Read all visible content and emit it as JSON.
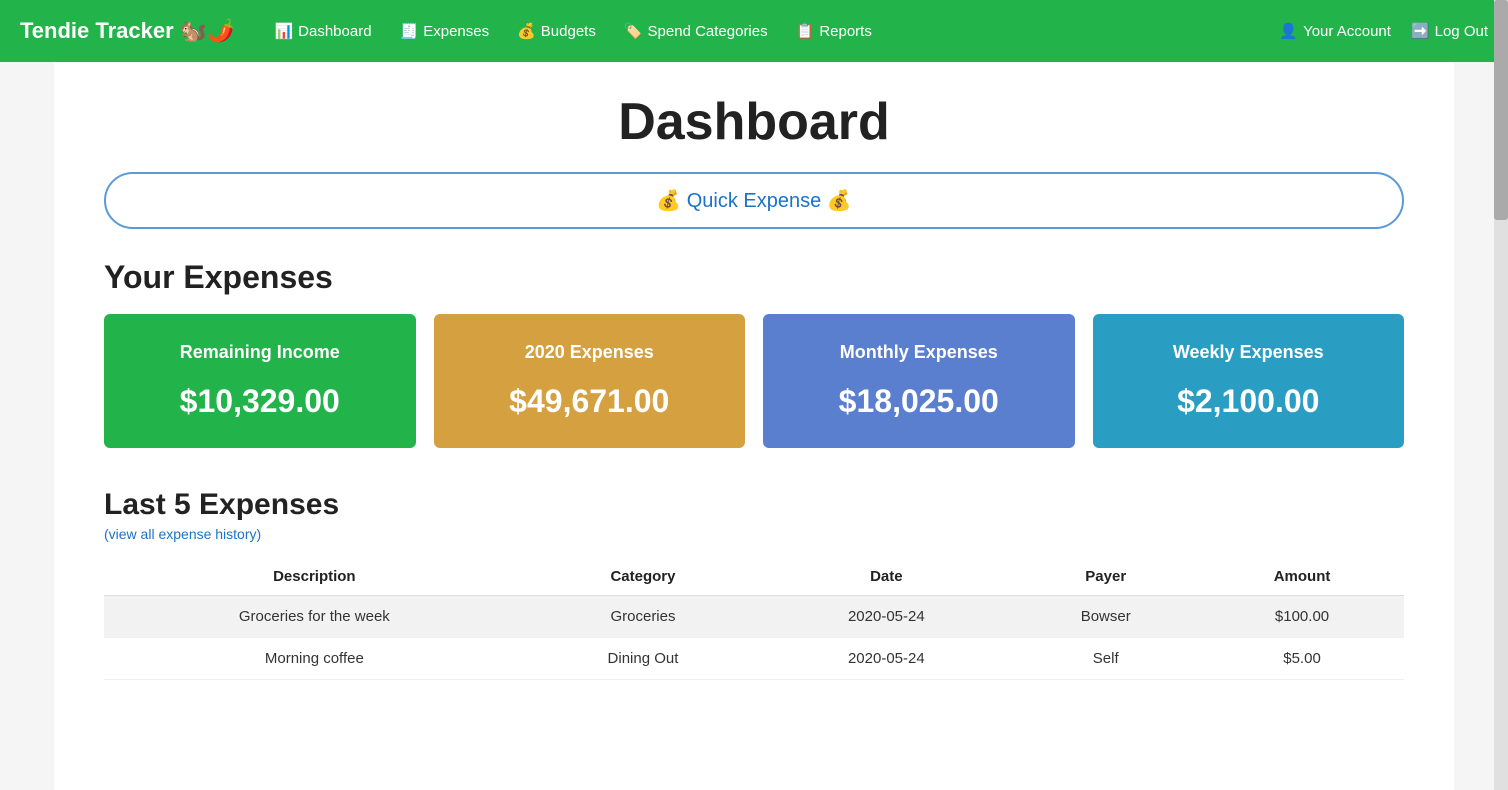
{
  "nav": {
    "brand": "Tendie Tracker",
    "brand_emoji": "🐿️🌶️",
    "links": [
      {
        "label": "Dashboard",
        "icon": "📊"
      },
      {
        "label": "Expenses",
        "icon": "🧾"
      },
      {
        "label": "Budgets",
        "icon": "💰"
      },
      {
        "label": "Spend Categories",
        "icon": "🏷️"
      },
      {
        "label": "Reports",
        "icon": "📋"
      }
    ],
    "account_label": "Your Account",
    "account_icon": "👤",
    "logout_label": "Log Out",
    "logout_icon": "➡️"
  },
  "page_title": "Dashboard",
  "quick_expense": {
    "label": "💰 Quick Expense 💰"
  },
  "expenses_section": {
    "title": "Your Expenses",
    "cards": [
      {
        "label": "Remaining Income",
        "value": "$10,329.00",
        "color_class": "card-green"
      },
      {
        "label": "2020 Expenses",
        "value": "$49,671.00",
        "color_class": "card-yellow"
      },
      {
        "label": "Monthly Expenses",
        "value": "$18,025.00",
        "color_class": "card-blue"
      },
      {
        "label": "Weekly Expenses",
        "value": "$2,100.00",
        "color_class": "card-teal"
      }
    ]
  },
  "last5_section": {
    "title": "Last 5 Expenses",
    "view_all_label": "(view all expense history)",
    "columns": [
      "Description",
      "Category",
      "Date",
      "Payer",
      "Amount"
    ],
    "rows": [
      {
        "description": "Groceries for the week",
        "category": "Groceries",
        "date": "2020-05-24",
        "payer": "Bowser",
        "amount": "$100.00"
      },
      {
        "description": "Morning coffee",
        "category": "Dining Out",
        "date": "2020-05-24",
        "payer": "Self",
        "amount": "$5.00"
      }
    ]
  }
}
